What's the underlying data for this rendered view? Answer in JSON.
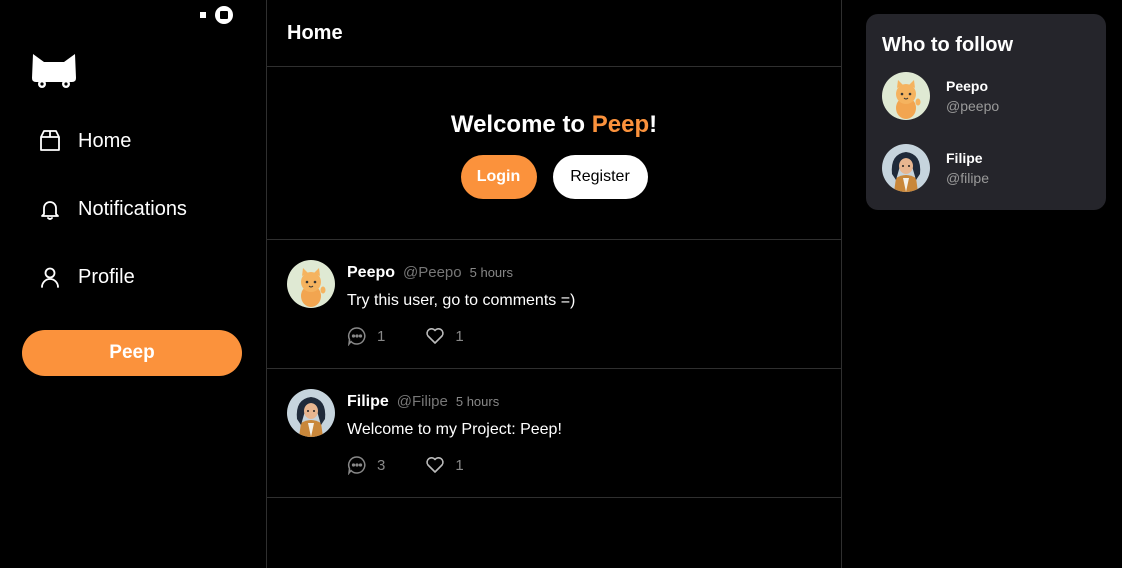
{
  "sidebar": {
    "nav": [
      {
        "label": "Home",
        "icon": "home-box-icon"
      },
      {
        "label": "Notifications",
        "icon": "bell-icon"
      },
      {
        "label": "Profile",
        "icon": "user-icon"
      }
    ],
    "peep_button": "Peep"
  },
  "main": {
    "title": "Home",
    "welcome": {
      "prefix": "Welcome to ",
      "brand": "Peep",
      "suffix": "!",
      "login": "Login",
      "register": "Register"
    },
    "posts": [
      {
        "name": "Peepo",
        "handle": "@Peepo",
        "time": "5 hours",
        "text": "Try this user, go to comments =)",
        "comments": "1",
        "likes": "1"
      },
      {
        "name": "Filipe",
        "handle": "@Filipe",
        "time": "5 hours",
        "text": "Welcome to my Project: Peep!",
        "comments": "3",
        "likes": "1"
      }
    ]
  },
  "who_to_follow": {
    "title": "Who to follow",
    "users": [
      {
        "name": "Peepo",
        "handle": "@peepo"
      },
      {
        "name": "Filipe",
        "handle": "@filipe"
      }
    ]
  },
  "colors": {
    "accent": "#fb923c",
    "background": "#000000",
    "panel": "#25252b",
    "muted": "#888888"
  }
}
